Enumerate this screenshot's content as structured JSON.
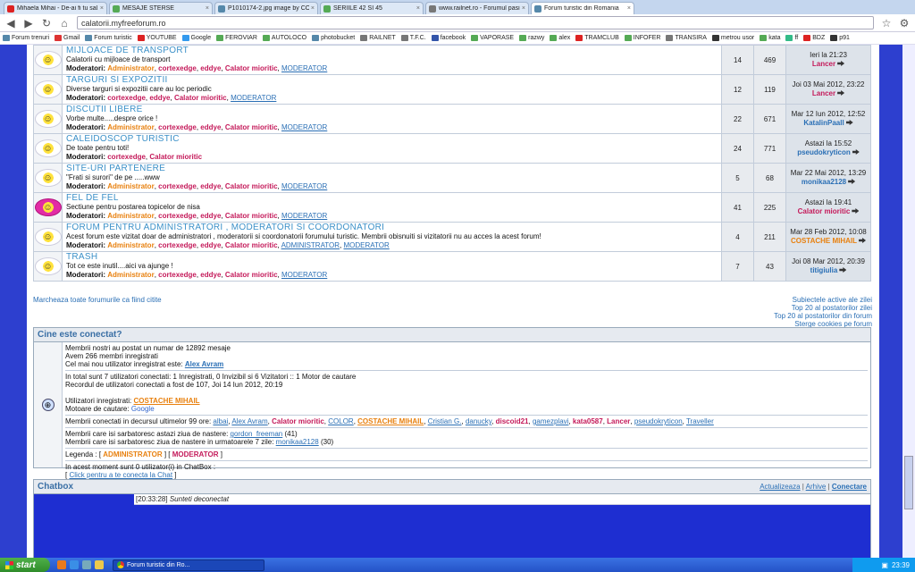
{
  "browser": {
    "tabs": [
      {
        "label": "Mihaela Mihai - De-ai fi tu sal...",
        "color": "#d22",
        "active": false
      },
      {
        "label": "MESAJE STERSE",
        "color": "#5a5",
        "active": false
      },
      {
        "label": "P1010174-2.jpg image by COL...",
        "color": "#58a",
        "active": false
      },
      {
        "label": "SERIILE 42 SI 45",
        "color": "#5a5",
        "active": false
      },
      {
        "label": "www.railnet.ro - Forumul pasi...",
        "color": "#777",
        "active": false
      },
      {
        "label": "Forum turistic din Romania",
        "color": "#58a",
        "active": true
      }
    ],
    "url": "calatorii.myfreeforum.ro",
    "bookmarks": [
      {
        "label": "Forum trenuri",
        "color": "#58a"
      },
      {
        "label": "Gmail",
        "color": "#d33"
      },
      {
        "label": "Forum turistic",
        "color": "#58a"
      },
      {
        "label": "YOUTUBE",
        "color": "#d22"
      },
      {
        "label": "Google",
        "color": "#39e"
      },
      {
        "label": "FEROVIAR",
        "color": "#5a5"
      },
      {
        "label": "AUTOLOCO",
        "color": "#5a5"
      },
      {
        "label": "photobucket",
        "color": "#58a"
      },
      {
        "label": "RAILNET",
        "color": "#777"
      },
      {
        "label": "T.F.C.",
        "color": "#777"
      },
      {
        "label": "facebook",
        "color": "#35a"
      },
      {
        "label": "VAPORASE",
        "color": "#5a5"
      },
      {
        "label": "razwy",
        "color": "#5a5"
      },
      {
        "label": "alex",
        "color": "#5a5"
      },
      {
        "label": "TRAMCLUB",
        "color": "#d22"
      },
      {
        "label": "INFOFER",
        "color": "#5a5"
      },
      {
        "label": "TRANSIRA",
        "color": "#777"
      },
      {
        "label": "metrou usor",
        "color": "#333"
      },
      {
        "label": "kata",
        "color": "#5a5"
      },
      {
        "label": "ff",
        "color": "#3b8"
      },
      {
        "label": "BDZ",
        "color": "#d22"
      },
      {
        "label": "p91",
        "color": "#333"
      }
    ]
  },
  "forums": [
    {
      "title": "MIJLOACE DE TRANSPORT",
      "desc": "Calatorii cu mijloace de transport",
      "topics": "14",
      "posts": "469",
      "last_date": "Ieri la 21:23",
      "last_user": "Lancer",
      "user_color": "red",
      "icon": "smiley",
      "mods": [
        {
          "n": "Administrator",
          "t": "a"
        },
        {
          "n": "cortexedge",
          "t": "m"
        },
        {
          "n": "eddye",
          "t": "m"
        },
        {
          "n": "Calator mioritic",
          "t": "m"
        },
        {
          "n": "MODERATOR",
          "t": "l"
        }
      ]
    },
    {
      "title": "TARGURI SI EXPOZITII",
      "desc": "Diverse targuri si expozitii care au loc periodic",
      "topics": "12",
      "posts": "119",
      "last_date": "Joi 03 Mai 2012, 23:22",
      "last_user": "Lancer",
      "user_color": "red",
      "icon": "smiley",
      "mods": [
        {
          "n": "cortexedge",
          "t": "m"
        },
        {
          "n": "eddye",
          "t": "m"
        },
        {
          "n": "Calator mioritic",
          "t": "m"
        },
        {
          "n": "MODERATOR",
          "t": "l"
        }
      ]
    },
    {
      "title": "DISCUTII LIBERE",
      "desc": "Vorbe multe.....despre orice !",
      "topics": "22",
      "posts": "671",
      "last_date": "Mar 12 Iun 2012, 12:52",
      "last_user": "KatalinPaall",
      "user_color": "blue",
      "icon": "smiley",
      "mods": [
        {
          "n": "Administrator",
          "t": "a"
        },
        {
          "n": "cortexedge",
          "t": "m"
        },
        {
          "n": "eddye",
          "t": "m"
        },
        {
          "n": "Calator mioritic",
          "t": "m"
        },
        {
          "n": "MODERATOR",
          "t": "l"
        }
      ]
    },
    {
      "title": "CALEIDOSCOP TURISTIC",
      "desc": "De toate pentru toti!",
      "topics": "24",
      "posts": "771",
      "last_date": "Astazi la 15:52",
      "last_user": "pseudokryticon",
      "user_color": "blue",
      "icon": "smiley",
      "mods": [
        {
          "n": "cortexedge",
          "t": "m"
        },
        {
          "n": "Calator mioritic",
          "t": "m"
        }
      ]
    },
    {
      "title": "SITE-URI PARTENERE",
      "desc": "\"Frati si surori\" de pe .....www",
      "topics": "5",
      "posts": "68",
      "last_date": "Mar 22 Mai 2012, 13:29",
      "last_user": "monikaa2128",
      "user_color": "blue",
      "icon": "smiley",
      "mods": [
        {
          "n": "Administrator",
          "t": "a"
        },
        {
          "n": "cortexedge",
          "t": "m"
        },
        {
          "n": "eddye",
          "t": "m"
        },
        {
          "n": "Calator mioritic",
          "t": "m"
        },
        {
          "n": "MODERATOR",
          "t": "l"
        }
      ]
    },
    {
      "title": "FEL DE FEL",
      "desc": "Sectiune pentru postarea topicelor de nisa",
      "topics": "41",
      "posts": "225",
      "last_date": "Astazi la 19:41",
      "last_user": "Calator mioritic",
      "user_color": "red",
      "icon": "flower",
      "mods": [
        {
          "n": "Administrator",
          "t": "a"
        },
        {
          "n": "cortexedge",
          "t": "m"
        },
        {
          "n": "eddye",
          "t": "m"
        },
        {
          "n": "Calator mioritic",
          "t": "m"
        },
        {
          "n": "MODERATOR",
          "t": "l"
        }
      ]
    },
    {
      "title": "FORUM PENTRU ADMINISTRATORI , MODERATORI SI COORDONATORI",
      "desc": "Acest forum este vizitat doar de administratori , moderatorii si coordonatorii forumului turistic. Membrii obisnuiti si vizitatorii nu au acces la acest forum!",
      "topics": "4",
      "posts": "211",
      "last_date": "Mar 28 Feb 2012, 10:08",
      "last_user": "COSTACHE MIHAIL",
      "user_color": "orange",
      "icon": "smiley",
      "mods": [
        {
          "n": "Administrator",
          "t": "a"
        },
        {
          "n": "cortexedge",
          "t": "m"
        },
        {
          "n": "eddye",
          "t": "m"
        },
        {
          "n": "Calator mioritic",
          "t": "m"
        },
        {
          "n": "ADMINISTRATOR",
          "t": "l"
        },
        {
          "n": "MODERATOR",
          "t": "l"
        }
      ]
    },
    {
      "title": "TRASH",
      "desc": "Tot ce este inutil....aici va ajunge !",
      "topics": "7",
      "posts": "43",
      "last_date": "Joi 08 Mar 2012, 20:39",
      "last_user": "titigiulia",
      "user_color": "blue",
      "icon": "smiley",
      "mods": [
        {
          "n": "Administrator",
          "t": "a"
        },
        {
          "n": "cortexedge",
          "t": "m"
        },
        {
          "n": "eddye",
          "t": "m"
        },
        {
          "n": "Calator mioritic",
          "t": "m"
        },
        {
          "n": "MODERATOR",
          "t": "l"
        }
      ]
    }
  ],
  "mod_label": "Moderatori:",
  "mark_all": "Marcheaza toate forumurile ca fiind citite",
  "right_links": [
    "Subiectele active ale zilei",
    "Top 20 al postatorilor zilei",
    "Top 20 al postatorilor din forum",
    "Sterge cookies pe forum"
  ],
  "online": {
    "header": "Cine este conectat?",
    "line1": "Membrii nostri au postat un numar de 12892 mesaje",
    "line2": "Avem 266 membri inregistrati",
    "line3_prefix": "Cel mai nou utilizator inregistrat este:",
    "newest_user": "Alex Avram",
    "line4": "In total sunt 7 utilizatori conectati: 1 Inregistrati, 0 Invizibil si 6 Vizitatori :: 1 Motor de cautare",
    "line5": "Recordul de utilizatori conectati a fost de 107, Joi 14 Iun 2012, 20:19",
    "registered_prefix": "Utilizatori inregistrati:",
    "registered_user": "COSTACHE MIHAIL",
    "bots_prefix": "Motoare de cautare:",
    "bot": "Google",
    "last99_prefix": "Membrii conectati in decursul ultimelor 99 ore:",
    "last99": [
      {
        "n": "albai",
        "c": "link"
      },
      {
        "n": "Alex Avram",
        "c": "link"
      },
      {
        "n": "Calator mioritic",
        "c": "red"
      },
      {
        "n": "COLOR",
        "c": "link"
      },
      {
        "n": "COSTACHE MIHAIL",
        "c": "orange"
      },
      {
        "n": "Cristian G.",
        "c": "link"
      },
      {
        "n": "danucky",
        "c": "link"
      },
      {
        "n": "discoid21",
        "c": "red"
      },
      {
        "n": "gamezplavi",
        "c": "link"
      },
      {
        "n": "kata0587",
        "c": "red"
      },
      {
        "n": "Lancer",
        "c": "red"
      },
      {
        "n": "pseudokryticon",
        "c": "link"
      },
      {
        "n": "Traveller",
        "c": "link"
      }
    ],
    "bday_today_prefix": "Membrii care isi sarbatoresc astazi ziua de nastere:",
    "bday_today_user": "gordon_freeman",
    "bday_today_age": "(41)",
    "bday_week_prefix": "Membrii care isi sarbatoresc ziua de nastere in urmatoarele 7 zile:",
    "bday_week_user": "monikaa2128",
    "bday_week_age": "(30)",
    "legend_prefix": "Legenda :",
    "legend_admin": "ADMINISTRATOR",
    "legend_mod": "MODERATOR",
    "chat_line": "In acest moment sunt 0 utilizator(i) in ChatBox :",
    "chat_link": "Click pentru a te conecta la Chat"
  },
  "chatbox": {
    "title": "Chatbox",
    "refresh": "Actualizeaza",
    "archive": "Arhive",
    "connect": "Conectare",
    "time": "[20:33:28]",
    "message": "Sunteti deconectat"
  },
  "taskbar": {
    "start": "start",
    "task": "Forum turistic din Ro...",
    "clock": "23:39"
  }
}
